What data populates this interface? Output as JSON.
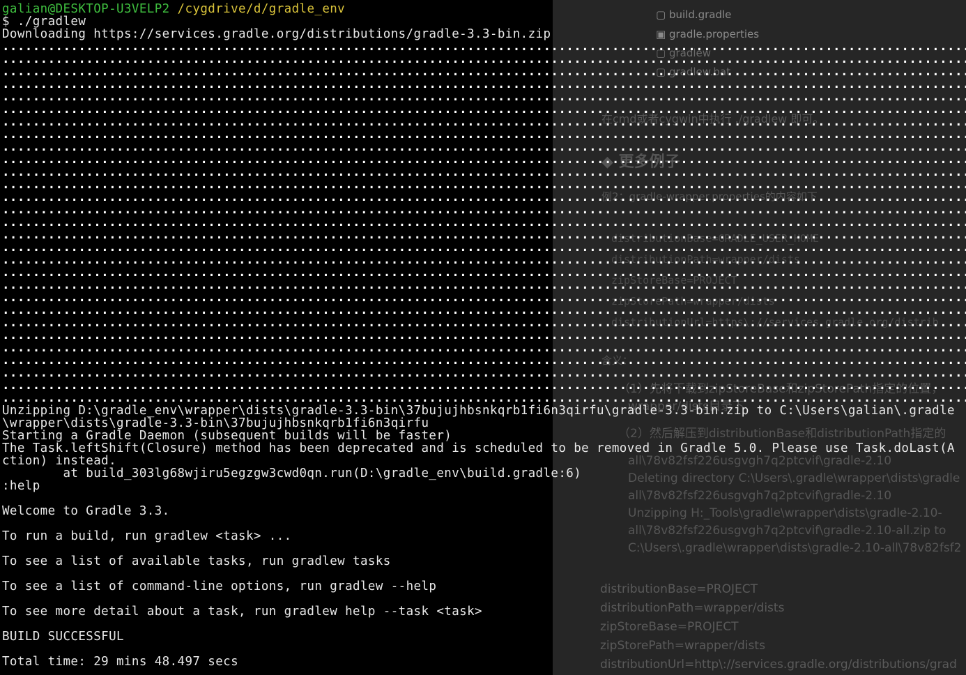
{
  "prompt": {
    "user_host": "galian@DESKTOP-U3VELP2",
    "path": "/cygdrive/d/gradle_env",
    "command": "$ ./gradlew"
  },
  "terminal_lines": {
    "downloading": "Downloading https://services.gradle.org/distributions/gradle-3.3-bin.zip",
    "unzip1": "Unzipping D:\\gradle_env\\wrapper\\dists\\gradle-3.3-bin\\37bujujhbsnkqrb1fi6n3qirfu\\gradle-3.3-bin.zip to C:\\Users\\galian\\.gradle",
    "unzip2": "\\wrapper\\dists\\gradle-3.3-bin\\37bujujhbsnkqrb1fi6n3qirfu",
    "daemon": "Starting a Gradle Daemon (subsequent builds will be faster)",
    "deprecated1": "The Task.leftShift(Closure) method has been deprecated and is scheduled to be removed in Gradle 5.0. Please use Task.doLast(A",
    "deprecated2": "ction) instead.",
    "at": "        at build_303lg68wjiru5egzgw3cwd0qn.run(D:\\gradle_env\\build.gradle:6)",
    "help": ":help",
    "welcome": "Welcome to Gradle 3.3.",
    "run_build": "To run a build, run gradlew <task> ...",
    "see_tasks": "To see a list of available tasks, run gradlew tasks",
    "see_options": "To see a list of command-line options, run gradlew --help",
    "see_detail": "To see more detail about a task, run gradlew help --task <task>",
    "build_success": "BUILD SUCCESSFUL",
    "total_time": "Total time: 29 mins 48.497 secs"
  },
  "background_doc": {
    "files": [
      "build.gradle",
      "gradle.properties",
      "gradlew",
      "gradlew.bat"
    ],
    "instruction": "在cmd或者cygwin中执行 ./gradlew 即可。",
    "heading": "◆ 更多例子",
    "example": "例2：gradle-wrapper.properties的内容如下",
    "props1": [
      "distributionBase=GRADLE_USER_HOME",
      "distributionPath=wrapper/dists",
      "zipStoreBase=PROJECT",
      "zipStorePath=wrapper/dists",
      "distributionUrl=https\\://services.gradle.org/distrib"
    ],
    "meaning": "含义：",
    "steps": [
      "（1）先将下载到zipStoreBase和zipStorePath指定的位置，",
      "wrapper/dists目录下",
      "（2）然后解压到distributionBase和distributionPath指定的",
      "all\\78v82fsf226usgvgh7q2ptcvif\\gradle-2.10",
      "Deleting directory C:\\Users\\.gradle\\wrapper\\dists\\gradle",
      "all\\78v82fsf226usgvgh7q2ptcvif\\gradle-2.10",
      "Unzipping H:_Tools\\gradle\\wrapper\\dists\\gradle-2.10-",
      "all\\78v82fsf226usgvgh7q2ptcvif\\gradle-2.10-all.zip to",
      "C:\\Users\\.gradle\\wrapper\\dists\\gradle-2.10-all\\78v82fsf2"
    ],
    "props2": [
      "distributionBase=PROJECT",
      "distributionPath=wrapper/dists",
      "zipStoreBase=PROJECT",
      "zipStorePath=wrapper/dists",
      "distributionUrl=http\\://services.gradle.org/distributions/grad"
    ]
  }
}
